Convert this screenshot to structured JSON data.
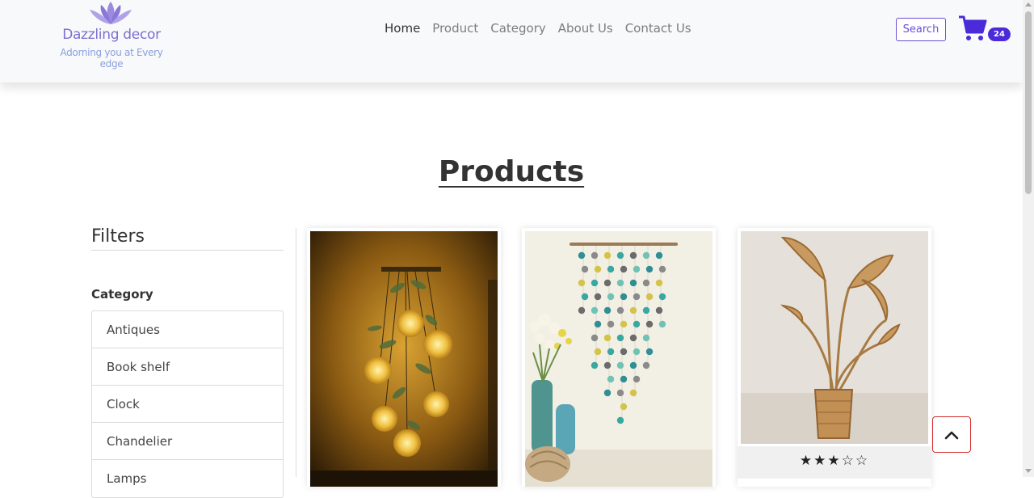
{
  "brand": {
    "name": "Dazzling decor",
    "tagline": "Adorning you at Every edge"
  },
  "nav": {
    "items": [
      {
        "label": "Home",
        "active": true
      },
      {
        "label": "Product",
        "active": false
      },
      {
        "label": "Category",
        "active": false
      },
      {
        "label": "About Us",
        "active": false
      },
      {
        "label": "Contact Us",
        "active": false
      }
    ]
  },
  "header_actions": {
    "search_label": "Search",
    "cart_icon": "cart-icon",
    "cart_count": "24"
  },
  "page": {
    "title": "Products"
  },
  "filters": {
    "title": "Filters",
    "category_label": "Category",
    "categories": [
      "Antiques",
      "Book shelf",
      "Clock",
      "Chandelier",
      "Lamps"
    ]
  },
  "products": [
    {
      "image": "hanging-chandelier-photo"
    },
    {
      "image": "pom-pom-wall-hanging-photo"
    },
    {
      "image": "rattan-leaf-plant-photo",
      "rating": 3,
      "max_rating": 5
    }
  ],
  "colors": {
    "accent": "#6c4fd6",
    "badge": "#4b2bd9",
    "back_to_top_border": "#d32f2f"
  }
}
